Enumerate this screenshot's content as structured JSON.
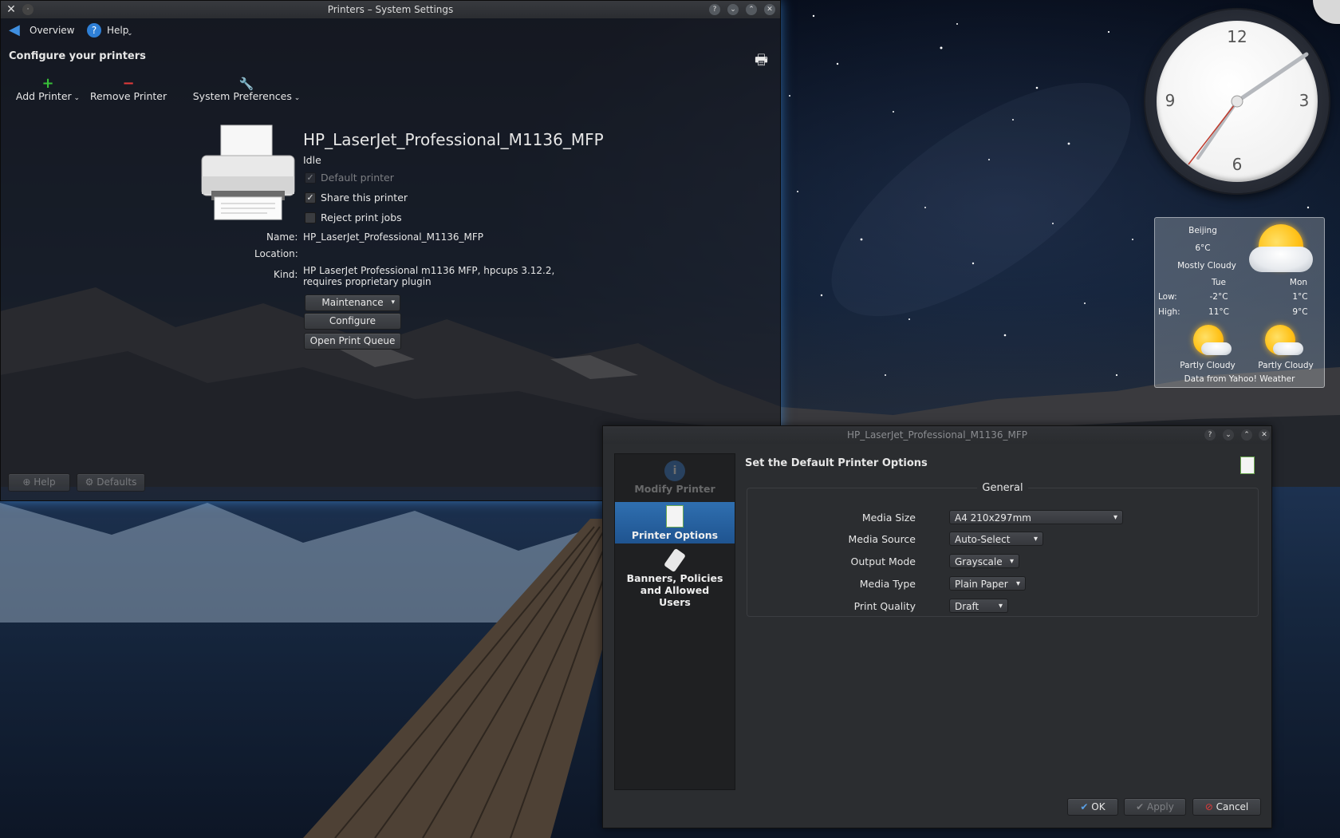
{
  "printers_window": {
    "title": "Printers – System Settings",
    "toolbar": {
      "overview_label": "Overview",
      "help_label": "Help"
    },
    "heading": "Configure your printers",
    "actions": {
      "add_printer": "Add Printer",
      "remove_printer": "Remove Printer",
      "system_preferences": "System Preferences"
    },
    "printer": {
      "name_title": "HP_LaserJet_Professional_M1136_MFP",
      "status": "Idle",
      "default_printer_label": "Default printer",
      "share_printer_label": "Share this printer",
      "reject_jobs_label": "Reject print jobs",
      "share_checked": true,
      "default_checked": true,
      "reject_checked": false,
      "name_label": "Name:",
      "name_value": "HP_LaserJet_Professional_M1136_MFP",
      "location_label": "Location:",
      "location_value": "",
      "kind_label": "Kind:",
      "kind_line1": "HP LaserJet Professional m1136 MFP, hpcups 3.12.2,",
      "kind_line2": "requires proprietary plugin",
      "maintenance_button": "Maintenance",
      "configure_button": "Configure",
      "open_queue_button": "Open Print Queue"
    },
    "footer": {
      "help_button": "Help",
      "defaults_button": "Defaults"
    }
  },
  "clock": {
    "numerals": [
      "12",
      "3",
      "6",
      "9"
    ]
  },
  "weather": {
    "city": "Beijing",
    "temp": "6°C",
    "condition": "Mostly Cloudy",
    "day1": "Tue",
    "day2": "Mon",
    "low_label": "Low:",
    "high_label": "High:",
    "day1_low": "-2°C",
    "day2_low": "1°C",
    "day1_high": "11°C",
    "day2_high": "9°C",
    "day1_condition": "Partly Cloudy",
    "day2_condition": "Partly Cloudy",
    "source": "Data from Yahoo! Weather"
  },
  "dialog": {
    "title": "HP_LaserJet_Professional_M1136_MFP",
    "header": "Set the Default Printer Options",
    "side_items": {
      "modify_printer": "Modify Printer",
      "printer_options": "Printer Options",
      "banners_line1": "Banners, Policies",
      "banners_line2": "and Allowed",
      "banners_line3": "Users"
    },
    "group_title": "General",
    "fields": {
      "media_size_label": "Media Size",
      "media_size_value": "A4 210x297mm",
      "media_source_label": "Media Source",
      "media_source_value": "Auto-Select",
      "output_mode_label": "Output Mode",
      "output_mode_value": "Grayscale",
      "media_type_label": "Media Type",
      "media_type_value": "Plain Paper",
      "print_quality_label": "Print Quality",
      "print_quality_value": "Draft"
    },
    "buttons": {
      "ok": "OK",
      "apply": "Apply",
      "cancel": "Cancel"
    }
  },
  "colors": {
    "accent": "#2f6fb0",
    "window_glow": "#46a0ff",
    "add_icon": "#38c038",
    "remove_icon": "#e03a3a"
  }
}
